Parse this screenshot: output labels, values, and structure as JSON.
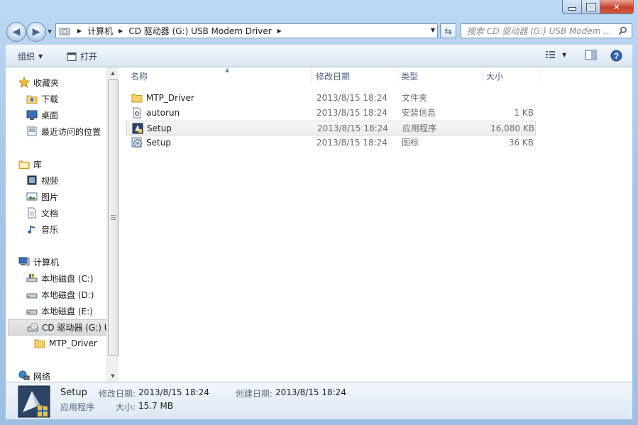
{
  "window": {
    "min_label": "",
    "max_label": "",
    "close_label": "×"
  },
  "address": {
    "crumbs": [
      "计算机",
      "CD 驱动器 (G:) USB Modem Driver"
    ]
  },
  "search": {
    "placeholder": "搜索 CD 驱动器 (G:) USB Modem ..."
  },
  "toolbar": {
    "organize": "组织",
    "open": "打开"
  },
  "nav": {
    "favorites": "收藏夹",
    "downloads": "下载",
    "desktop": "桌面",
    "recent": "最近访问的位置",
    "libraries": "库",
    "videos": "视频",
    "pictures": "图片",
    "documents": "文档",
    "music": "音乐",
    "computer": "计算机",
    "drive_c": "本地磁盘 (C:)",
    "drive_d": "本地磁盘 (D:)",
    "drive_e": "本地磁盘 (E:)",
    "drive_g": "CD 驱动器 (G:) U",
    "mtp": "MTP_Driver",
    "network": "网络"
  },
  "columns": {
    "name": "名称",
    "date": "修改日期",
    "type": "类型",
    "size": "大小"
  },
  "files": [
    {
      "name": "MTP_Driver",
      "date": "2013/8/15 18:24",
      "type": "文件夹",
      "size": "",
      "icon": "folder-icon"
    },
    {
      "name": "autorun",
      "date": "2013/8/15 18:24",
      "type": "安装信息",
      "size": "1 KB",
      "icon": "settings-file-icon"
    },
    {
      "name": "Setup",
      "date": "2013/8/15 18:24",
      "type": "应用程序",
      "size": "16,080 KB",
      "icon": "setup-app-icon"
    },
    {
      "name": "Setup",
      "date": "2013/8/15 18:24",
      "type": "图标",
      "size": "36 KB",
      "icon": "disc-icon"
    }
  ],
  "details": {
    "name": "Setup",
    "type": "应用程序",
    "modified_label": "修改日期:",
    "modified": "2013/8/15 18:24",
    "created_label": "创建日期:",
    "created": "2013/8/15 18:24",
    "size_label": "大小:",
    "size": "15.7 MB"
  }
}
